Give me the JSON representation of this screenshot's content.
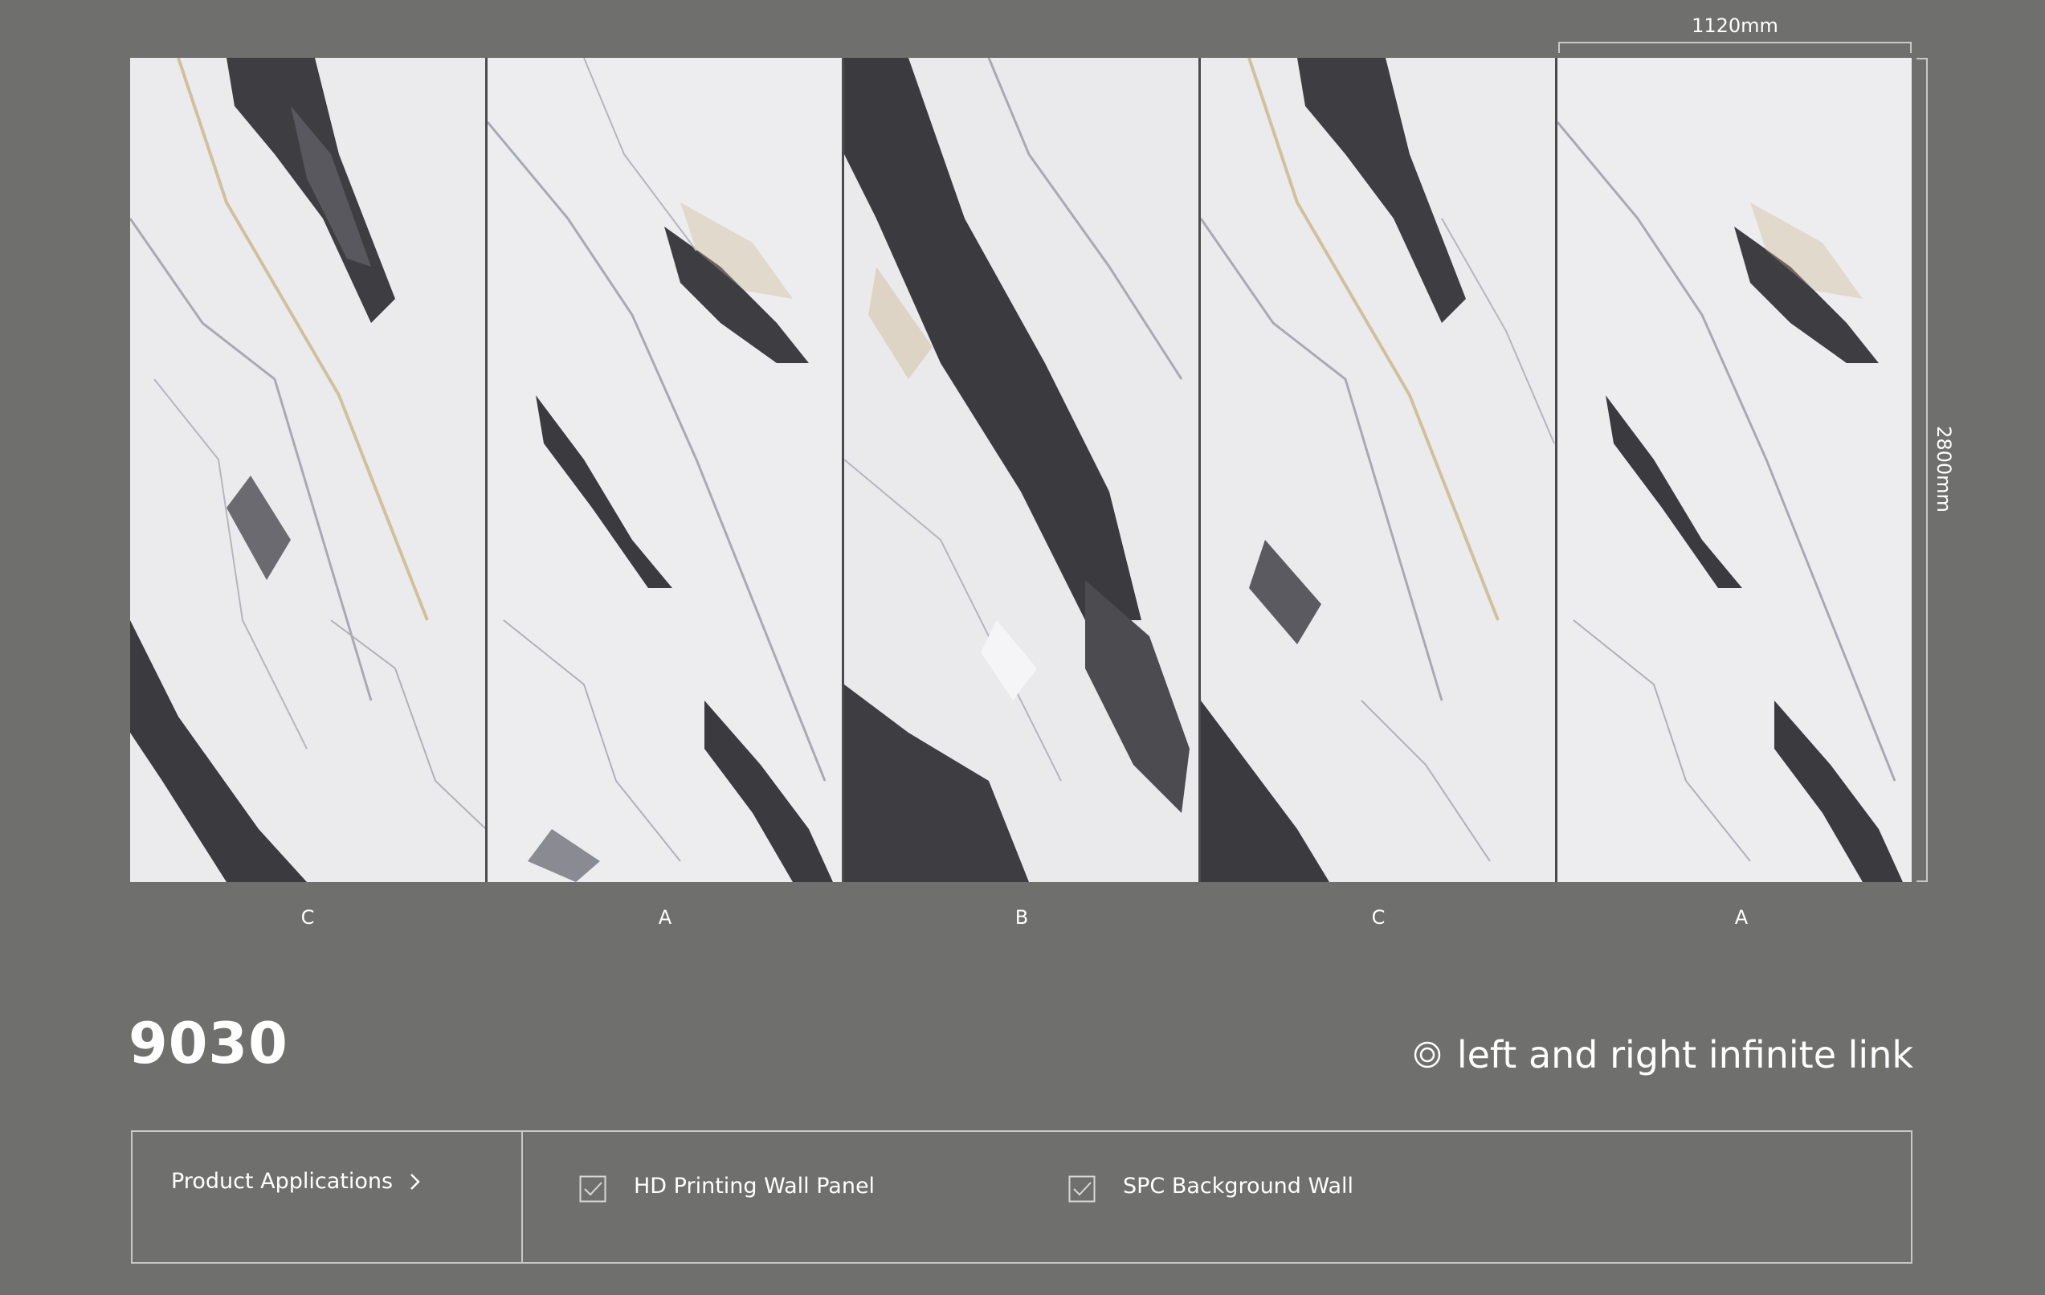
{
  "dimensions": {
    "width_label": "1120mm",
    "height_label": "2800mm"
  },
  "panels": [
    {
      "label": "C"
    },
    {
      "label": "A"
    },
    {
      "label": "B"
    },
    {
      "label": "C"
    },
    {
      "label": "A"
    }
  ],
  "product": {
    "code": "9030",
    "feature": "left and right infinite link",
    "feature_icon": "double-circle-icon"
  },
  "applications": {
    "heading": "Product Applications",
    "heading_icon": "chevron-right-icon",
    "items": [
      {
        "label": "HD Printing Wall Panel",
        "checked": true
      },
      {
        "label": "SPC Background Wall",
        "checked": true
      }
    ]
  },
  "colors": {
    "background": "#6f6f6d",
    "marble_base": "#e9e9ec",
    "vein_dark": "#3a3a3f",
    "vein_gold": "#cbb58a",
    "line": "#c9c9c9"
  }
}
